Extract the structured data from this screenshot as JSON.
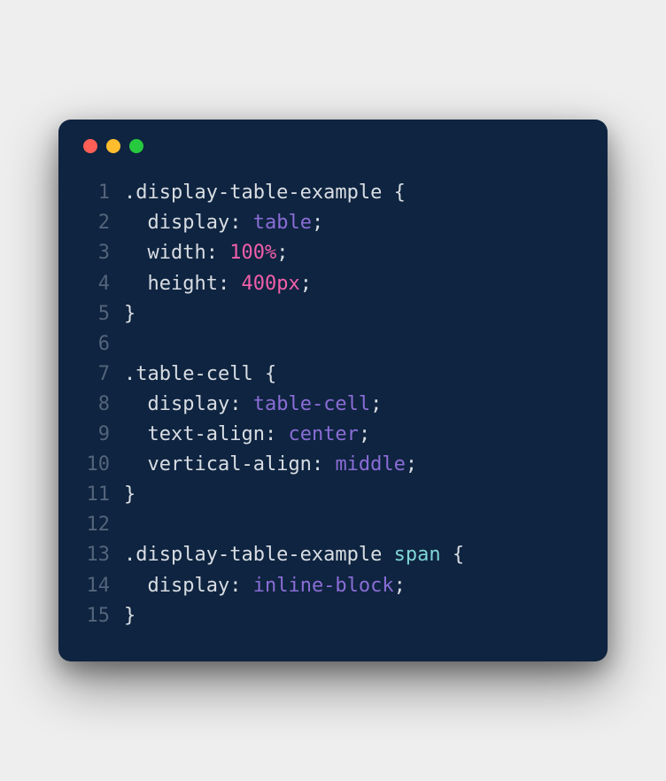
{
  "code": {
    "language": "css",
    "lines": [
      {
        "num": 1,
        "tokens": [
          {
            "t": ".display-table-example ",
            "c": "selector"
          },
          {
            "t": "{",
            "c": "brace"
          }
        ]
      },
      {
        "num": 2,
        "tokens": [
          {
            "t": "  ",
            "c": "plain"
          },
          {
            "t": "display",
            "c": "prop"
          },
          {
            "t": ": ",
            "c": "colon"
          },
          {
            "t": "table",
            "c": "value-keyword"
          },
          {
            "t": ";",
            "c": "semi"
          }
        ]
      },
      {
        "num": 3,
        "tokens": [
          {
            "t": "  ",
            "c": "plain"
          },
          {
            "t": "width",
            "c": "prop"
          },
          {
            "t": ": ",
            "c": "colon"
          },
          {
            "t": "100%",
            "c": "number"
          },
          {
            "t": ";",
            "c": "semi"
          }
        ]
      },
      {
        "num": 4,
        "tokens": [
          {
            "t": "  ",
            "c": "plain"
          },
          {
            "t": "height",
            "c": "prop"
          },
          {
            "t": ": ",
            "c": "colon"
          },
          {
            "t": "400px",
            "c": "number"
          },
          {
            "t": ";",
            "c": "semi"
          }
        ]
      },
      {
        "num": 5,
        "tokens": [
          {
            "t": "}",
            "c": "brace"
          }
        ]
      },
      {
        "num": 6,
        "tokens": [
          {
            "t": "",
            "c": "plain"
          }
        ]
      },
      {
        "num": 7,
        "tokens": [
          {
            "t": ".table-cell ",
            "c": "selector"
          },
          {
            "t": "{",
            "c": "brace"
          }
        ]
      },
      {
        "num": 8,
        "tokens": [
          {
            "t": "  ",
            "c": "plain"
          },
          {
            "t": "display",
            "c": "prop"
          },
          {
            "t": ": ",
            "c": "colon"
          },
          {
            "t": "table-cell",
            "c": "value-keyword"
          },
          {
            "t": ";",
            "c": "semi"
          }
        ]
      },
      {
        "num": 9,
        "tokens": [
          {
            "t": "  ",
            "c": "plain"
          },
          {
            "t": "text-align",
            "c": "prop"
          },
          {
            "t": ": ",
            "c": "colon"
          },
          {
            "t": "center",
            "c": "value-keyword"
          },
          {
            "t": ";",
            "c": "semi"
          }
        ]
      },
      {
        "num": 10,
        "tokens": [
          {
            "t": "  ",
            "c": "plain"
          },
          {
            "t": "vertical-align",
            "c": "prop"
          },
          {
            "t": ": ",
            "c": "colon"
          },
          {
            "t": "middle",
            "c": "value-keyword"
          },
          {
            "t": ";",
            "c": "semi"
          }
        ]
      },
      {
        "num": 11,
        "tokens": [
          {
            "t": "}",
            "c": "brace"
          }
        ]
      },
      {
        "num": 12,
        "tokens": [
          {
            "t": "",
            "c": "plain"
          }
        ]
      },
      {
        "num": 13,
        "tokens": [
          {
            "t": ".display-table-example ",
            "c": "selector"
          },
          {
            "t": "span",
            "c": "tag"
          },
          {
            "t": " {",
            "c": "brace"
          }
        ]
      },
      {
        "num": 14,
        "tokens": [
          {
            "t": "  ",
            "c": "plain"
          },
          {
            "t": "display",
            "c": "prop"
          },
          {
            "t": ": ",
            "c": "colon"
          },
          {
            "t": "inline-block",
            "c": "value-keyword"
          },
          {
            "t": ";",
            "c": "semi"
          }
        ]
      },
      {
        "num": 15,
        "tokens": [
          {
            "t": "}",
            "c": "brace"
          }
        ]
      }
    ]
  }
}
